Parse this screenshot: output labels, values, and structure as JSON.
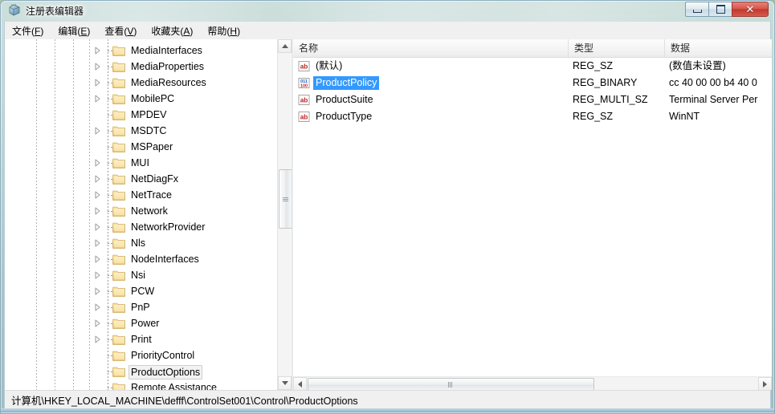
{
  "window": {
    "title": "注册表编辑器",
    "app_icon": "registry-editor-icon",
    "caption": {
      "minimize_label": "–",
      "maximize_label": "□",
      "close_label": "✕"
    }
  },
  "menubar": {
    "items": [
      {
        "label": "文件(F)",
        "accel": "F"
      },
      {
        "label": "编辑(E)",
        "accel": "E"
      },
      {
        "label": "查看(V)",
        "accel": "V"
      },
      {
        "label": "收藏夹(A)",
        "accel": "A"
      },
      {
        "label": "帮助(H)",
        "accel": "H"
      }
    ]
  },
  "tree": {
    "nodes": [
      {
        "label": "MediaInterfaces",
        "expandable": true,
        "selected": false
      },
      {
        "label": "MediaProperties",
        "expandable": true,
        "selected": false
      },
      {
        "label": "MediaResources",
        "expandable": true,
        "selected": false
      },
      {
        "label": "MobilePC",
        "expandable": true,
        "selected": false
      },
      {
        "label": "MPDEV",
        "expandable": false,
        "selected": false
      },
      {
        "label": "MSDTC",
        "expandable": true,
        "selected": false
      },
      {
        "label": "MSPaper",
        "expandable": false,
        "selected": false
      },
      {
        "label": "MUI",
        "expandable": true,
        "selected": false
      },
      {
        "label": "NetDiagFx",
        "expandable": true,
        "selected": false
      },
      {
        "label": "NetTrace",
        "expandable": true,
        "selected": false
      },
      {
        "label": "Network",
        "expandable": true,
        "selected": false
      },
      {
        "label": "NetworkProvider",
        "expandable": true,
        "selected": false
      },
      {
        "label": "Nls",
        "expandable": true,
        "selected": false
      },
      {
        "label": "NodeInterfaces",
        "expandable": true,
        "selected": false
      },
      {
        "label": "Nsi",
        "expandable": true,
        "selected": false
      },
      {
        "label": "PCW",
        "expandable": true,
        "selected": false
      },
      {
        "label": "PnP",
        "expandable": true,
        "selected": false
      },
      {
        "label": "Power",
        "expandable": true,
        "selected": false
      },
      {
        "label": "Print",
        "expandable": true,
        "selected": false
      },
      {
        "label": "PriorityControl",
        "expandable": false,
        "selected": false
      },
      {
        "label": "ProductOptions",
        "expandable": false,
        "selected": true
      },
      {
        "label": "Remote Assistance",
        "expandable": false,
        "selected": false
      }
    ]
  },
  "list": {
    "columns": [
      {
        "label": "名称"
      },
      {
        "label": "类型"
      },
      {
        "label": "数据"
      }
    ],
    "rows": [
      {
        "name": "(默认)",
        "type": "REG_SZ",
        "data": "(数值未设置)",
        "icon": "string-value-icon",
        "selected": false
      },
      {
        "name": "ProductPolicy",
        "type": "REG_BINARY",
        "data": "cc 40 00 00 b4 40 0",
        "icon": "binary-value-icon",
        "selected": true
      },
      {
        "name": "ProductSuite",
        "type": "REG_MULTI_SZ",
        "data": "Terminal Server Per",
        "icon": "string-value-icon",
        "selected": false
      },
      {
        "name": "ProductType",
        "type": "REG_SZ",
        "data": "WinNT",
        "icon": "string-value-icon",
        "selected": false
      }
    ]
  },
  "statusbar": {
    "path": "计算机\\HKEY_LOCAL_MACHINE\\defff\\ControlSet001\\Control\\ProductOptions"
  },
  "colors": {
    "selection_blue": "#3399ff",
    "selection_gray": "#f2f2f2",
    "close_button_red": "#c0392c",
    "folder_yellow": "#fcd980"
  }
}
